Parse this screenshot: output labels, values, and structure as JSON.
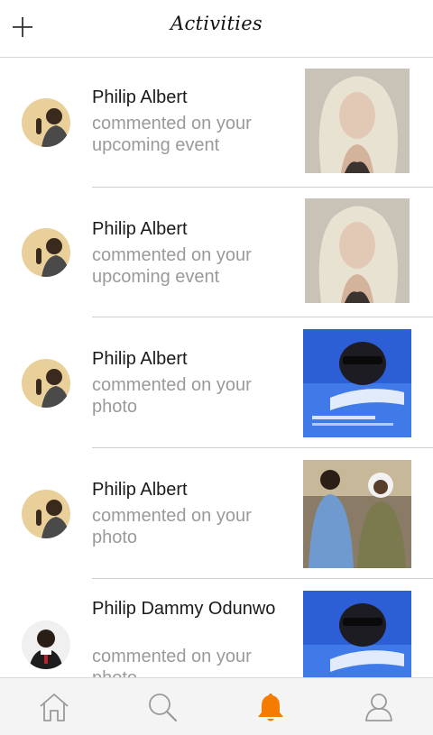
{
  "header": {
    "title": "Activities"
  },
  "activities": [
    {
      "name": "Philip Albert",
      "action": "commented on your upcoming event",
      "thumb_icon": "portrait-photo-thumbnail"
    },
    {
      "name": "Philip Albert",
      "action": "commented on your upcoming event",
      "thumb_icon": "portrait-photo-thumbnail"
    },
    {
      "name": "Philip Albert",
      "action": "commented on your photo",
      "thumb_icon": "event-flyer-thumbnail"
    },
    {
      "name": "Philip Albert",
      "action": "commented on your photo",
      "thumb_icon": "couple-photo-thumbnail"
    },
    {
      "name": "Philip Dammy Odunwo",
      "action": "commented on your photo",
      "thumb_icon": "event-flyer-thumbnail"
    }
  ],
  "tabbar": {
    "items": [
      "home-icon",
      "search-icon",
      "bell-icon",
      "profile-icon"
    ],
    "active": "bell-icon",
    "active_color": "#f57c00",
    "inactive_color": "#9a9a9a"
  }
}
